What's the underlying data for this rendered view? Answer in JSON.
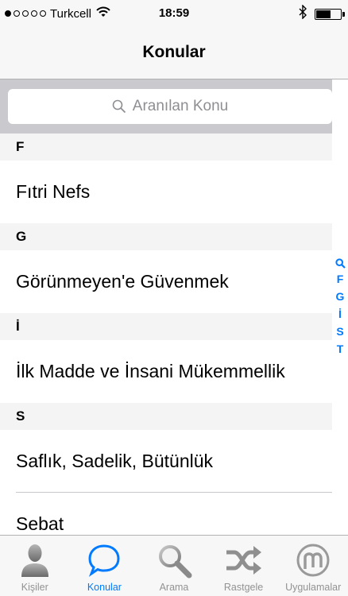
{
  "status_bar": {
    "carrier": "Turkcell",
    "time": "18:59",
    "signal_dots_filled": 1,
    "signal_dots_total": 5,
    "battery_level": 0.55
  },
  "nav": {
    "title": "Konular"
  },
  "search": {
    "placeholder": "Aranılan Konu"
  },
  "sections": [
    {
      "header": "F",
      "rows": [
        "Fıtri Nefs"
      ]
    },
    {
      "header": "G",
      "rows": [
        "Görünmeyen'e Güvenmek"
      ]
    },
    {
      "header": "İ",
      "rows": [
        "İlk Madde ve İnsani Mükemmellik"
      ]
    },
    {
      "header": "S",
      "rows": [
        "Saflık, Sadelik, Bütünlük",
        "Sebat"
      ]
    }
  ],
  "section_index": {
    "search_icon": "search-icon",
    "letters": [
      "F",
      "G",
      "İ",
      "S",
      "T"
    ]
  },
  "tab_bar": {
    "active_index": 1,
    "tabs": [
      {
        "label": "Kişiler",
        "icon": "person-icon"
      },
      {
        "label": "Konular",
        "icon": "speech-bubble-icon"
      },
      {
        "label": "Arama",
        "icon": "magnifier-icon"
      },
      {
        "label": "Rastgele",
        "icon": "shuffle-icon"
      },
      {
        "label": "Uygulamalar",
        "icon": "apps-m-icon"
      }
    ]
  },
  "colors": {
    "accent": "#007aff",
    "inactive": "#929292",
    "bar_background": "#f7f7f7",
    "section_header": "#f4f4f4",
    "search_area": "#c9c9ce"
  }
}
